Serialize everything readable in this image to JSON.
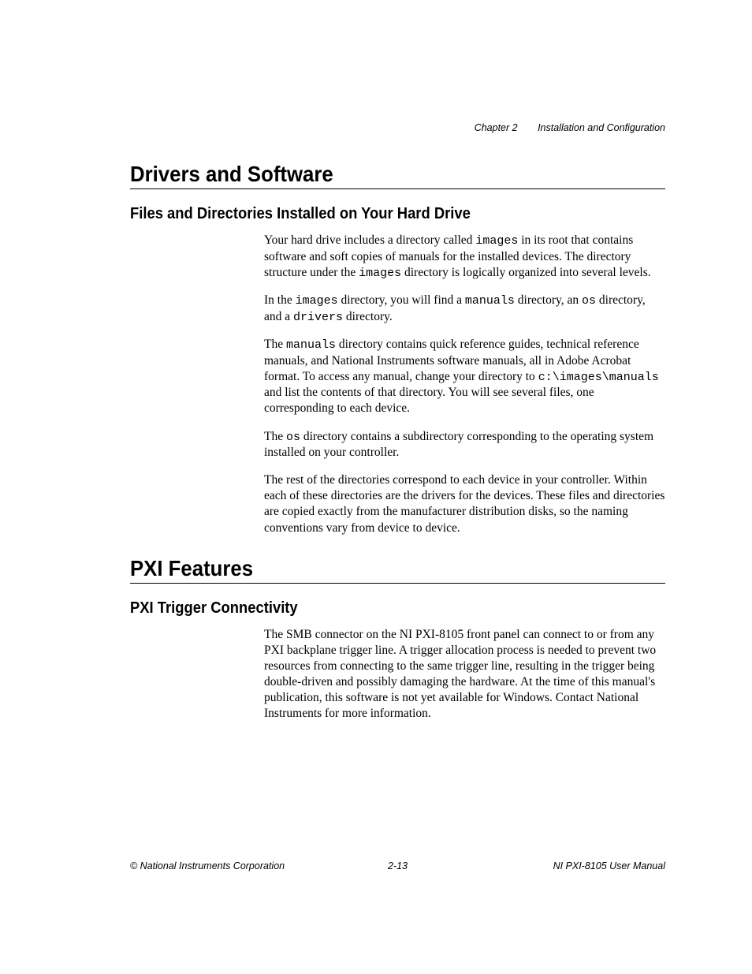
{
  "header": {
    "chapter": "Chapter 2",
    "title": "Installation and Configuration"
  },
  "section1": {
    "heading": "Drivers and Software",
    "subheading": "Files and Directories Installed on Your Hard Drive",
    "p1a": "Your hard drive includes a directory called ",
    "p1_code1": "images",
    "p1b": " in its root that contains software and soft copies of manuals for the installed devices. The directory structure under the ",
    "p1_code2": "images",
    "p1c": " directory is logically organized into several levels.",
    "p2a": "In the ",
    "p2_code1": "images",
    "p2b": " directory, you will find a ",
    "p2_code2": "manuals",
    "p2c": " directory, an ",
    "p2_code3": "os",
    "p2d": " directory, and a ",
    "p2_code4": "drivers",
    "p2e": " directory.",
    "p3a": "The ",
    "p3_code1": "manuals",
    "p3b": " directory contains quick reference guides, technical reference manuals, and National Instruments software manuals, all in Adobe Acrobat format. To access any manual, change your directory to ",
    "p3_code2": "c:\\images\\manuals",
    "p3c": " and list the contents of that directory. You will see several files, one corresponding to each device.",
    "p4a": "The ",
    "p4_code1": "os",
    "p4b": " directory contains a subdirectory corresponding to the operating system installed on your controller.",
    "p5": "The rest of the directories correspond to each device in your controller. Within each of these directories are the drivers for the devices. These files and directories are copied exactly from the manufacturer distribution disks, so the naming conventions vary from device to device."
  },
  "section2": {
    "heading": "PXI Features",
    "subheading": "PXI Trigger Connectivity",
    "p1": "The SMB connector on the NI PXI-8105 front panel can connect to or from any PXI backplane trigger line. A trigger allocation process is needed to prevent two resources from connecting to the same trigger line, resulting in the trigger being double-driven and possibly damaging the hardware. At the time of this manual's publication, this software is not yet available for Windows. Contact National Instruments for more information."
  },
  "footer": {
    "left": "© National Instruments Corporation",
    "center": "2-13",
    "right": "NI PXI-8105 User Manual"
  }
}
